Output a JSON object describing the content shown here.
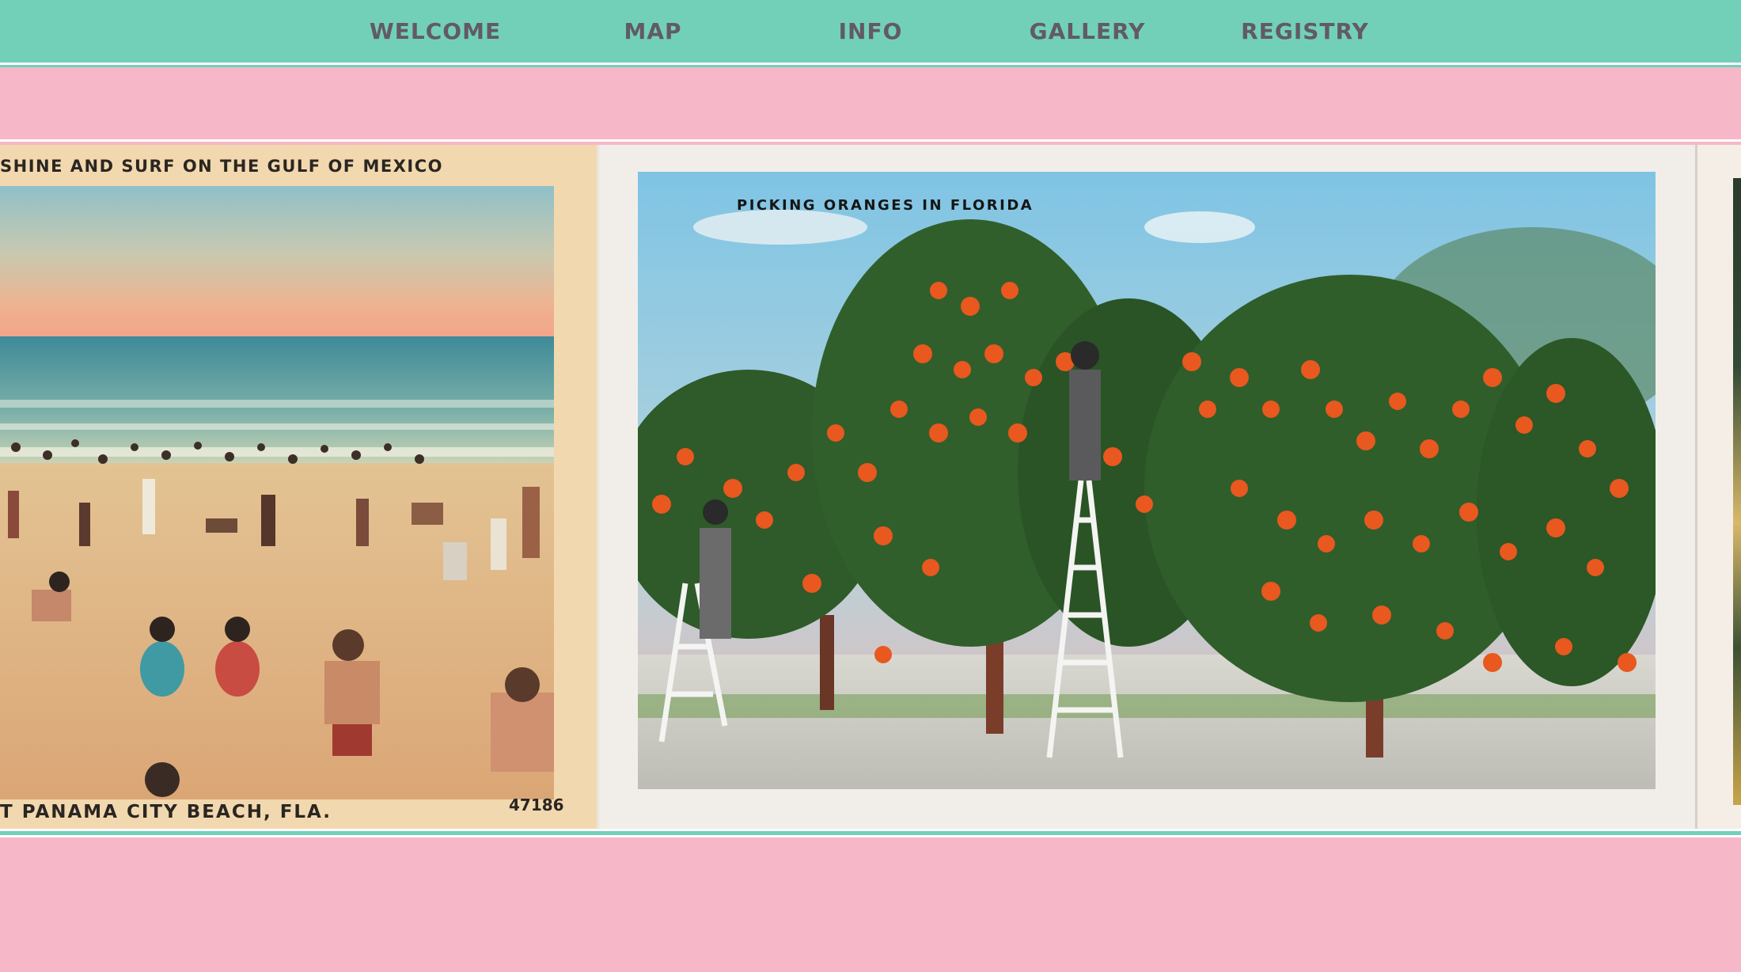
{
  "nav": {
    "items": [
      {
        "label": "WELCOME"
      },
      {
        "label": "MAP"
      },
      {
        "label": "INFO"
      },
      {
        "label": "GALLERY"
      },
      {
        "label": "REGISTRY"
      }
    ]
  },
  "colors": {
    "nav_background": "#72d0b9",
    "nav_text": "#625a66",
    "page_background": "#f6b8c9",
    "accent_line": "#ffffff"
  },
  "gallery": {
    "beach_card": {
      "caption_top": "SHINE AND SURF ON THE GULF OF MEXICO",
      "caption_bottom": "T PANAMA CITY BEACH, FLA.",
      "serial": "47186"
    },
    "oranges_card": {
      "caption": "PICKING ORANGES IN FLORIDA"
    }
  }
}
